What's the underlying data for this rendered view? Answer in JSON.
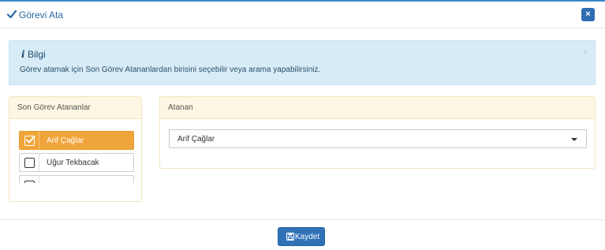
{
  "modal": {
    "title": "Görevi Ata",
    "close_label": "×"
  },
  "alert": {
    "title": "Bilgi",
    "message": "Görev atamak için Son Görev Atananlardan birisini seçebilir veya arama yapabilirsiniz.",
    "close_label": "×"
  },
  "recent_panel": {
    "title": "Son Görev Atananlar",
    "items": [
      {
        "label": "Arif Çağlar",
        "checked": true
      },
      {
        "label": "Uğur Tekbacak",
        "checked": false
      },
      {
        "label": "",
        "checked": false
      }
    ]
  },
  "assignee_panel": {
    "title": "Atanan",
    "selected_value": "Arif Çağlar"
  },
  "footer": {
    "save_label": "Kaydet"
  },
  "colors": {
    "accent": "#2f72b7",
    "active_item": "#f0a53b",
    "alert_bg": "#d8ecf7",
    "panel_head_bg": "#fcf6e3"
  }
}
